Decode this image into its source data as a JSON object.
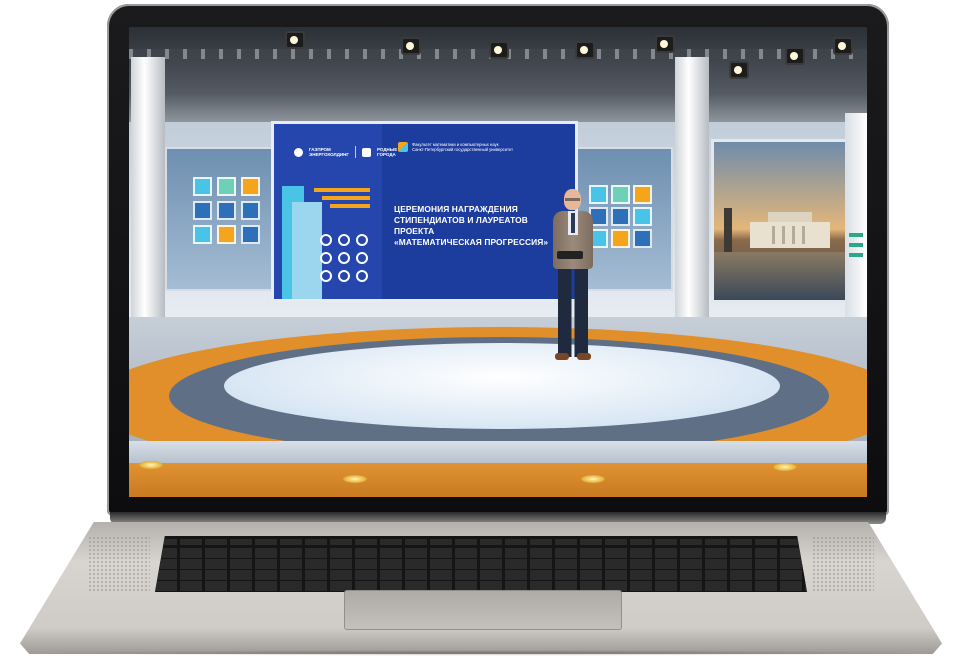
{
  "scene": {
    "description_type": "laptop-mockup-with-virtual-studio"
  },
  "video_wall": {
    "partner_logo_1": "ГАЗПРОМ\nЭНЕРГОХОЛДИНГ",
    "partner_logo_2": "РОДНЫЕ\nГОРОДА",
    "faculty_line_1": "Факультет математики и компьютерных наук",
    "faculty_line_2": "Санкт-Петербургский государственный университет",
    "headline_line_1": "ЦЕРЕМОНИЯ НАГРАЖДЕНИЯ",
    "headline_line_2": "СТИПЕНДИАТОВ И ЛАУРЕАТОВ ПРОЕКТА",
    "headline_line_3": "«МАТЕМАТИЧЕСКАЯ ПРОГРЕССИЯ»"
  },
  "colors": {
    "wall_blue": "#1d3d9e",
    "accent_orange": "#f4a51c",
    "accent_cyan": "#49c3e6",
    "floor_orange": "#e08f2b"
  }
}
